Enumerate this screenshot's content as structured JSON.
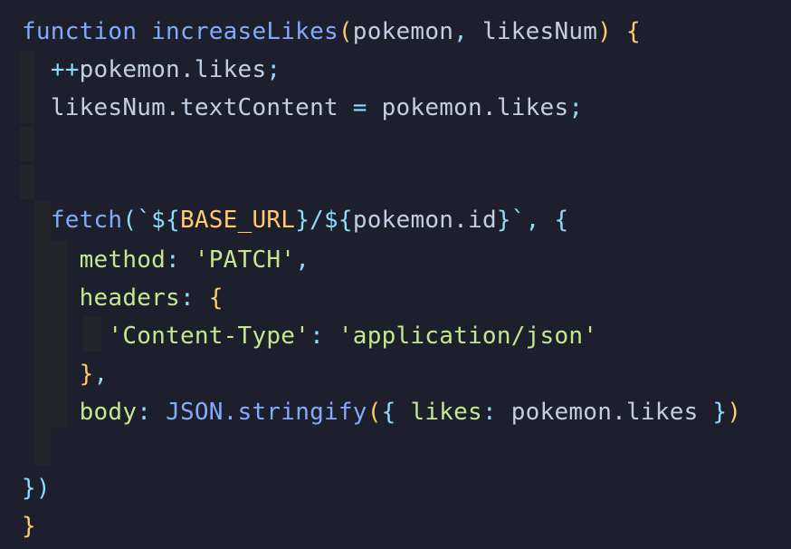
{
  "editor": {
    "lines": [
      {
        "tokens": [
          {
            "text": "function ",
            "cls": "t-kw"
          },
          {
            "text": "increaseLikes",
            "cls": "t-fn"
          },
          {
            "text": "(",
            "cls": "t-brace"
          },
          {
            "text": "pokemon",
            "cls": "t-plain"
          },
          {
            "text": ", ",
            "cls": "t-punc"
          },
          {
            "text": "likesNum",
            "cls": "t-plain"
          },
          {
            "text": ") {",
            "cls": "t-brace"
          }
        ]
      },
      {
        "tokens": [
          {
            "text": "  ",
            "cls": "t-plain"
          },
          {
            "text": "++",
            "cls": "t-punc"
          },
          {
            "text": "pokemon.likes",
            "cls": "t-plain"
          },
          {
            "text": ";",
            "cls": "t-punc"
          }
        ]
      },
      {
        "tokens": [
          {
            "text": "  ",
            "cls": "t-plain"
          },
          {
            "text": "likesNum.textContent",
            "cls": "t-plain"
          },
          {
            "text": " = ",
            "cls": "t-punc"
          },
          {
            "text": "pokemon.likes",
            "cls": "t-plain"
          },
          {
            "text": ";",
            "cls": "t-punc"
          }
        ]
      },
      {
        "tokens": [
          {
            "text": "",
            "cls": "t-plain"
          }
        ]
      },
      {
        "tokens": [
          {
            "text": "",
            "cls": "t-plain"
          }
        ]
      },
      {
        "tokens": [
          {
            "text": "  ",
            "cls": "t-plain"
          },
          {
            "text": "fetch",
            "cls": "t-fn"
          },
          {
            "text": "(`${",
            "cls": "t-punc"
          },
          {
            "text": "BASE_URL",
            "cls": "t-var"
          },
          {
            "text": "}/${",
            "cls": "t-punc"
          },
          {
            "text": "pokemon.id",
            "cls": "t-plain"
          },
          {
            "text": "}`, {",
            "cls": "t-punc"
          }
        ]
      },
      {
        "tokens": [
          {
            "text": "    ",
            "cls": "t-plain"
          },
          {
            "text": "method",
            "cls": "t-prop"
          },
          {
            "text": ": ",
            "cls": "t-punc"
          },
          {
            "text": "'PATCH'",
            "cls": "t-str"
          },
          {
            "text": ",",
            "cls": "t-punc"
          }
        ]
      },
      {
        "tokens": [
          {
            "text": "    ",
            "cls": "t-plain"
          },
          {
            "text": "headers",
            "cls": "t-prop"
          },
          {
            "text": ": ",
            "cls": "t-punc"
          },
          {
            "text": "{",
            "cls": "t-brace"
          }
        ]
      },
      {
        "tokens": [
          {
            "text": "      ",
            "cls": "t-plain"
          },
          {
            "text": "'Content-Type'",
            "cls": "t-str"
          },
          {
            "text": ": ",
            "cls": "t-punc"
          },
          {
            "text": "'application/json'",
            "cls": "t-str"
          }
        ]
      },
      {
        "tokens": [
          {
            "text": "    ",
            "cls": "t-plain"
          },
          {
            "text": "}",
            "cls": "t-brace"
          },
          {
            "text": ",",
            "cls": "t-punc"
          }
        ]
      },
      {
        "tokens": [
          {
            "text": "    ",
            "cls": "t-plain"
          },
          {
            "text": "body",
            "cls": "t-prop"
          },
          {
            "text": ": ",
            "cls": "t-punc"
          },
          {
            "text": "JSON.stringify",
            "cls": "t-fn"
          },
          {
            "text": "(",
            "cls": "t-brace"
          },
          {
            "text": "{ ",
            "cls": "t-punc"
          },
          {
            "text": "likes",
            "cls": "t-prop"
          },
          {
            "text": ": ",
            "cls": "t-punc"
          },
          {
            "text": "pokemon.likes",
            "cls": "t-plain"
          },
          {
            "text": " }",
            "cls": "t-punc"
          },
          {
            "text": ")",
            "cls": "t-brace"
          }
        ]
      },
      {
        "tokens": [
          {
            "text": "",
            "cls": "t-plain"
          }
        ]
      },
      {
        "tokens": [
          {
            "text": "})",
            "cls": "t-punc"
          }
        ]
      },
      {
        "tokens": [
          {
            "text": "}",
            "cls": "t-brace"
          }
        ]
      }
    ]
  }
}
